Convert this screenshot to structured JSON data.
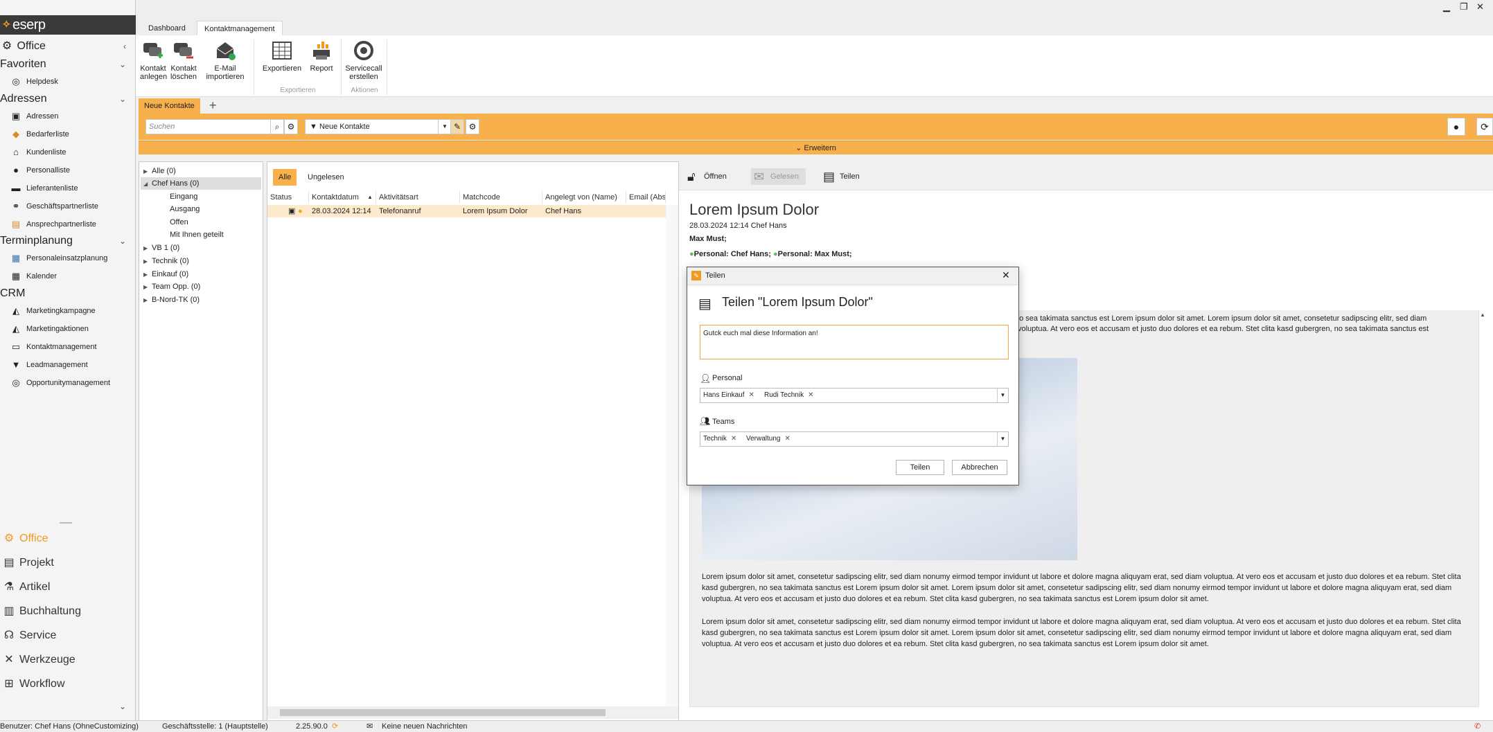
{
  "app": {
    "logo_text": "eserp"
  },
  "window": {
    "minimize": "▁",
    "restore": "❐",
    "close": "✕"
  },
  "topbar": {
    "tabs": [
      "Dashboard",
      "Kontaktmanagement"
    ]
  },
  "sidebar": {
    "office_header": "Office",
    "sections": [
      {
        "title": "Favoriten",
        "items": [
          {
            "label": "Helpdesk",
            "icon": "lifebuoy-icon"
          }
        ]
      },
      {
        "title": "Adressen",
        "items": [
          {
            "label": "Adressen",
            "icon": "address-book-icon"
          },
          {
            "label": "Bedarferliste",
            "icon": "bookmark-icon"
          },
          {
            "label": "Kundenliste",
            "icon": "house-icon"
          },
          {
            "label": "Personalliste",
            "icon": "person-icon"
          },
          {
            "label": "Lieferantenliste",
            "icon": "truck-icon"
          },
          {
            "label": "Geschäftspartnerliste",
            "icon": "handshake-icon"
          },
          {
            "label": "Ansprechpartnerliste",
            "icon": "contact-icon"
          }
        ]
      },
      {
        "title": "Terminplanung",
        "items": [
          {
            "label": "Personaleinsatzplanung",
            "icon": "schedule-icon"
          },
          {
            "label": "Kalender",
            "icon": "calendar-icon"
          }
        ]
      },
      {
        "title": "CRM",
        "items": [
          {
            "label": "Marketingkampagne",
            "icon": "megaphone-icon"
          },
          {
            "label": "Marketingaktionen",
            "icon": "megaphone-icon"
          },
          {
            "label": "Kontaktmanagement",
            "icon": "chat-icon"
          },
          {
            "label": "Leadmanagement",
            "icon": "funnel-icon"
          },
          {
            "label": "Opportunitymanagement",
            "icon": "target-icon"
          }
        ]
      }
    ],
    "modules": [
      {
        "label": "Office",
        "active": true
      },
      {
        "label": "Projekt"
      },
      {
        "label": "Artikel"
      },
      {
        "label": "Buchhaltung"
      },
      {
        "label": "Service"
      },
      {
        "label": "Werkzeuge"
      },
      {
        "label": "Workflow"
      }
    ]
  },
  "ribbon": {
    "buttons": [
      {
        "label1": "Kontakt",
        "label2": "anlegen",
        "icon": "add-contact-icon"
      },
      {
        "label1": "Kontakt",
        "label2": "löschen",
        "icon": "delete-contact-icon"
      },
      {
        "label1": "E-Mail",
        "label2": "importieren",
        "icon": "mail-import-icon"
      },
      {
        "label1": "Exportieren",
        "label2": "",
        "icon": "table-export-icon"
      },
      {
        "label1": "Report",
        "label2": "",
        "icon": "report-print-icon"
      },
      {
        "label1": "Servicecall",
        "label2": "erstellen",
        "icon": "servicecall-icon"
      }
    ],
    "groups": [
      "Exportieren",
      "Aktionen"
    ]
  },
  "doc_tab": "Neue Kontakte",
  "filter": {
    "search_placeholder": "Suchen",
    "selected": "Neue Kontakte",
    "expand_label": "Erweitern"
  },
  "tree": [
    {
      "label": "Alle (0)",
      "level": 0,
      "arrow": true
    },
    {
      "label": "Chef Hans (0)",
      "level": 0,
      "arrow": true,
      "open": true,
      "selected": true
    },
    {
      "label": "Eingang",
      "level": 1
    },
    {
      "label": "Ausgang",
      "level": 1
    },
    {
      "label": "Offen",
      "level": 1
    },
    {
      "label": "Mit Ihnen geteilt",
      "level": 1
    },
    {
      "label": "VB 1 (0)",
      "level": 0,
      "arrow": true
    },
    {
      "label": "Technik (0)",
      "level": 0,
      "arrow": true
    },
    {
      "label": "Einkauf (0)",
      "level": 0,
      "arrow": true
    },
    {
      "label": "Team Opp. (0)",
      "level": 0,
      "arrow": true
    },
    {
      "label": "B-Nord-TK (0)",
      "level": 0,
      "arrow": true
    }
  ],
  "list": {
    "filters": [
      "Alle",
      "Ungelesen"
    ],
    "columns": [
      "Status",
      "Kontaktdatum",
      "Aktivitätsart",
      "Matchcode",
      "Angelegt von (Name)",
      "Email (Abs"
    ],
    "rows": [
      {
        "datum": "28.03.2024 12:14",
        "art": "Telefonanruf",
        "matchcode": "Lorem Ipsum Dolor",
        "angelegt": "Chef Hans"
      }
    ]
  },
  "detail": {
    "toolbar": [
      "Öffnen",
      "Gelesen",
      "Teilen"
    ],
    "title": "Lorem Ipsum Dolor",
    "meta": "28.03.2024 12:14 Chef Hans",
    "to": "Max Must;",
    "personal1": "Personal:  Chef Hans;",
    "personal2": "Personal:  Max Must;",
    "text_frag1": "no sea takimata sanctus est Lorem ipsum dolor sit amet. Lorem ipsum dolor sit amet, consetetur sadipscing elitr, sed diam",
    "text_frag2": "voluptua. At vero eos et accusam et justo duo dolores et ea rebum. Stet clita kasd gubergren, no sea takimata sanctus est",
    "para": "Lorem ipsum dolor sit amet, consetetur sadipscing elitr, sed diam nonumy eirmod tempor invidunt ut labore et dolore magna aliquyam erat, sed diam voluptua. At vero eos et accusam et justo duo dolores et ea rebum. Stet clita kasd gubergren, no sea takimata sanctus est Lorem ipsum dolor sit amet. Lorem ipsum dolor sit amet, consetetur sadipscing elitr, sed diam nonumy eirmod tempor invidunt ut labore et dolore magna aliquyam erat, sed diam voluptua. At vero eos et accusam et justo duo dolores et ea rebum. Stet clita kasd gubergren, no sea takimata sanctus est Lorem ipsum dolor sit amet."
  },
  "dialog": {
    "window_title": "Teilen",
    "heading": "Teilen \"Lorem Ipsum Dolor\"",
    "message": "Gutck euch mal diese Information an!",
    "personal_label": "Personal",
    "personal_tags": [
      "Hans Einkauf",
      "Rudi Technik"
    ],
    "teams_label": "Teams",
    "team_tags": [
      "Technik",
      "Verwaltung"
    ],
    "ok": "Teilen",
    "cancel": "Abbrechen"
  },
  "status": {
    "user": "Benutzer: Chef Hans (OhneCustomizing)",
    "branch": "Geschäftsstelle: 1 (Hauptstelle)",
    "version": "2.25.90.0",
    "messages": "Keine neuen Nachrichten"
  },
  "colors": {
    "accent": "#f7b04b",
    "logo_bg": "#3a3a3a",
    "active_module": "#f29a1f"
  }
}
